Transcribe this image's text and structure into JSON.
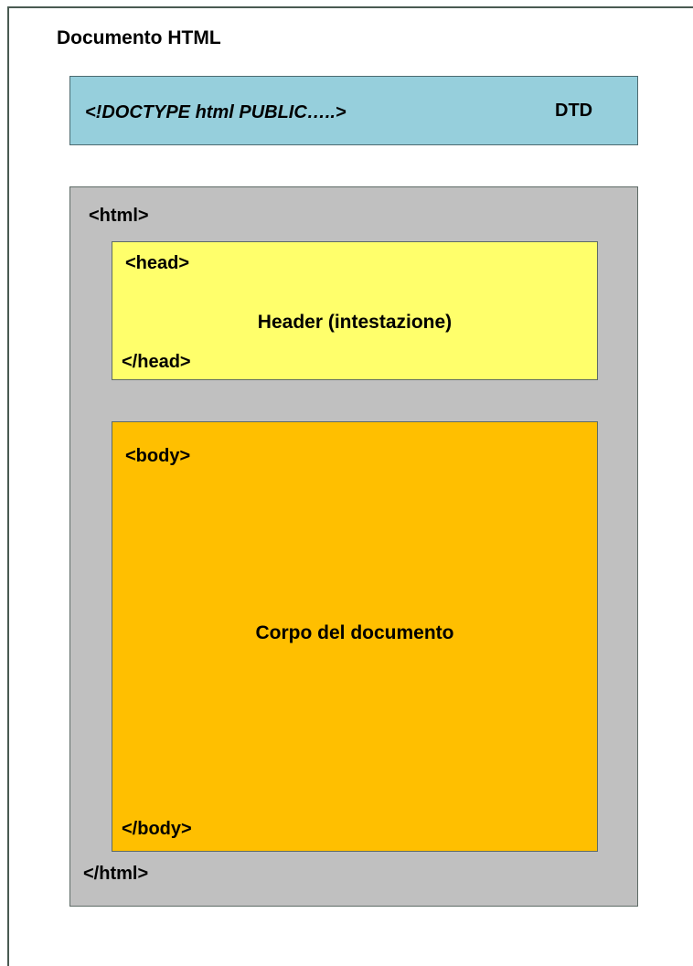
{
  "diagram": {
    "title": "Documento HTML",
    "dtd": {
      "doctype": "<!DOCTYPE html PUBLIC…..>",
      "label": "DTD",
      "color": "#96cfdc"
    },
    "html": {
      "open_tag": "<html>",
      "close_tag": "</html>",
      "color": "#c0c0c0",
      "head": {
        "open_tag": "<head>",
        "close_tag": "</head>",
        "caption": "Header (intestazione)",
        "color": "#ffff6b"
      },
      "body": {
        "open_tag": "<body>",
        "close_tag": "</body>",
        "caption": "Corpo del documento",
        "color": "#ffbf00"
      }
    }
  }
}
